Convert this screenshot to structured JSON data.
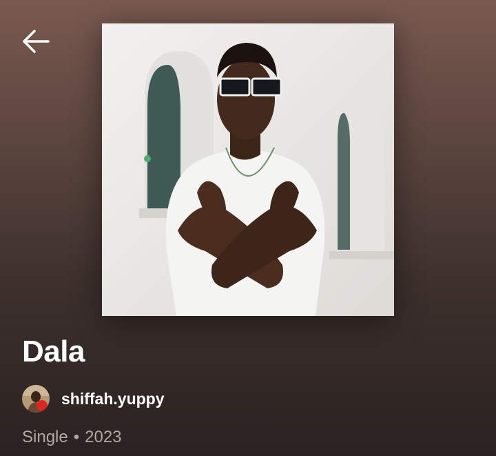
{
  "header": {
    "back_icon": "arrow-left-icon"
  },
  "release": {
    "title": "Dala",
    "artist": "shiffah.yuppy",
    "type": "Single",
    "separator": "•",
    "year": "2023",
    "cover_icon": "album-cover-photo",
    "avatar_icon": "artist-avatar-photo"
  },
  "colors": {
    "background_top": "#7a5a50",
    "background_bottom": "#2a2221",
    "text_primary": "#ffffff",
    "text_secondary": "#b3a8a4"
  }
}
